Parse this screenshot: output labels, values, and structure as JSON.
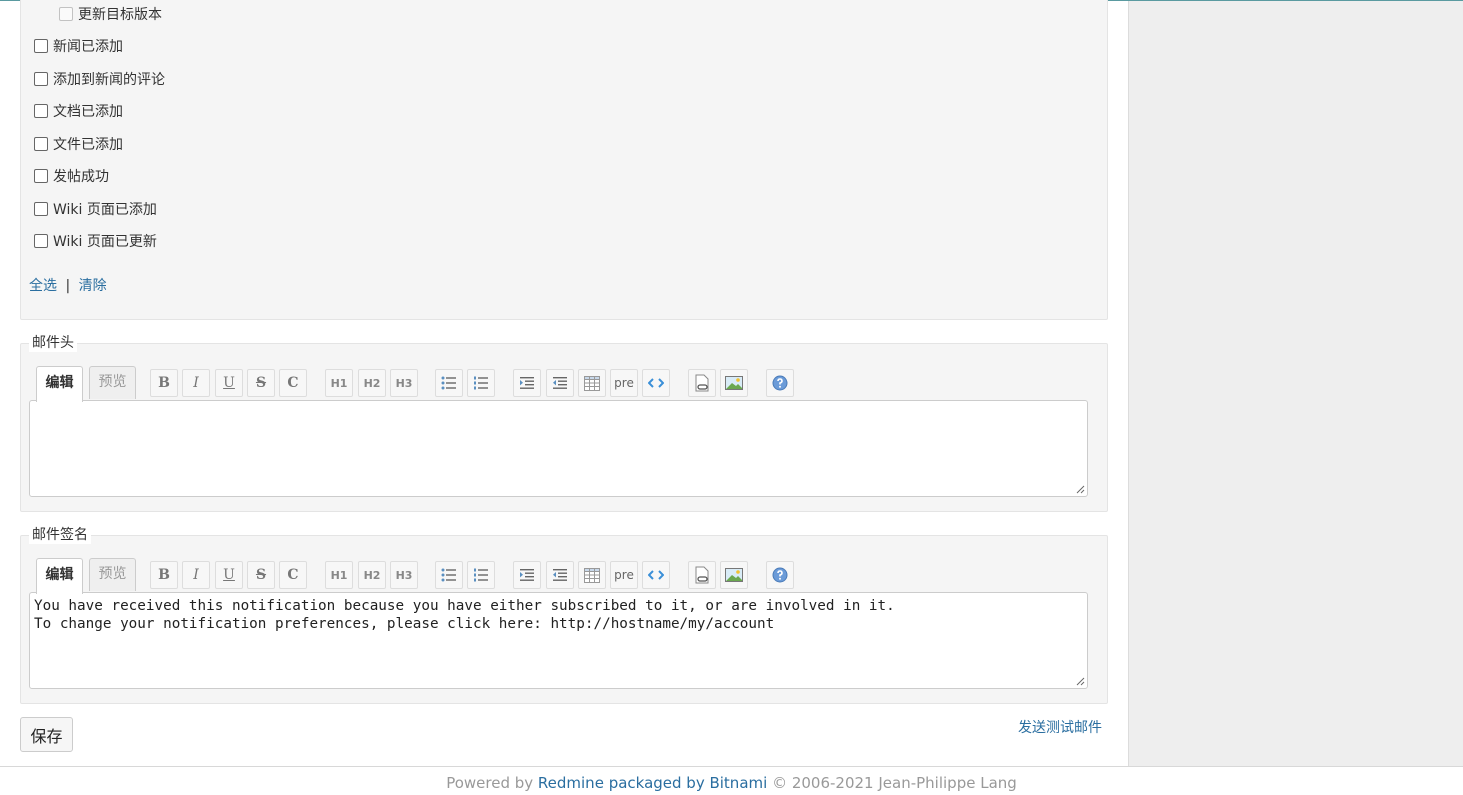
{
  "notifications": {
    "sub_item": "更新目标版本",
    "items": [
      "新闻已添加",
      "添加到新闻的评论",
      "文档已添加",
      "文件已添加",
      "发帖成功",
      "Wiki 页面已添加",
      "Wiki 页面已更新"
    ],
    "select_all": "全选",
    "separator": "|",
    "clear": "清除"
  },
  "header_section": {
    "legend": "邮件头",
    "tab_edit": "编辑",
    "tab_preview": "预览",
    "value": ""
  },
  "signature_section": {
    "legend": "邮件签名",
    "tab_edit": "编辑",
    "tab_preview": "预览",
    "value": "You have received this notification because you have either subscribed to it, or are involved in it.\nTo change your notification preferences, please click here: http://hostname/my/account"
  },
  "toolbar": {
    "buttons": [
      "bold",
      "italic",
      "underline",
      "strikethrough",
      "inline-code",
      "h1",
      "h2",
      "h3",
      "unordered-list",
      "ordered-list",
      "quote",
      "unquote",
      "table",
      "pre",
      "code-highlight",
      "link-to-page",
      "image",
      "help"
    ],
    "labels": {
      "bold": "B",
      "italic": "I",
      "underline": "U",
      "strike": "S",
      "code": "C",
      "h1": "H1",
      "h2": "H2",
      "h3": "H3",
      "pre": "pre"
    }
  },
  "actions": {
    "save": "保存",
    "send_test": "发送测试邮件"
  },
  "footer": {
    "powered_by": "Powered by ",
    "redmine": "Redmine packaged by Bitnami",
    "copyright": " © 2006-2021 Jean-Philippe Lang"
  },
  "colors": {
    "link": "#2a6ea0",
    "panel_bg": "#f5f5f5",
    "sidebar_bg": "#eeeeee"
  }
}
